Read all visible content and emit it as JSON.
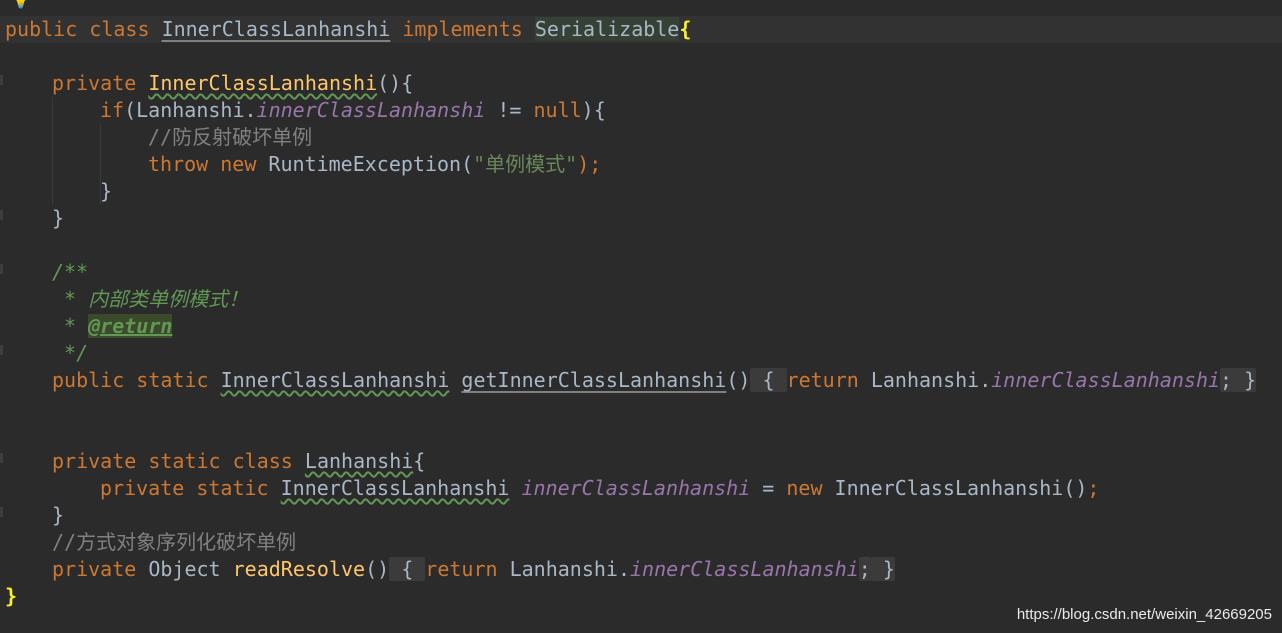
{
  "editor": {
    "lines": {
      "l1": {
        "kw1": "public",
        "kw2": "class",
        "name": "InnerClassLanhanshi",
        "kw3": "implements",
        "iface": "Serializable",
        "brace": "{"
      },
      "l3": {
        "kw1": "private",
        "name": "InnerClassLanhanshi",
        "rest": "(){"
      },
      "l4": {
        "kw": "if",
        "p1": "(Lanhanshi.",
        "field": "innerClassLanhanshi",
        "op": " != ",
        "nul": "null",
        "p2": "){"
      },
      "l5": {
        "comment": "//防反射破坏单例"
      },
      "l6": {
        "kw1": "throw",
        "kw2": "new",
        "cls": " RuntimeException(",
        "str": "\"单例模式\"",
        "end": ");"
      },
      "l7": {
        "text": "}"
      },
      "l8": {
        "text": "}"
      },
      "l10": {
        "text": "/**"
      },
      "l11": {
        "text": " * 内部类单例模式！"
      },
      "l12": {
        "prefix": " * ",
        "tag": "@return"
      },
      "l13": {
        "text": " */"
      },
      "l14": {
        "kw1": "public",
        "kw2": "static",
        "type": "InnerClassLanhanshi",
        "method": "getInnerClassLanhanshi",
        "paren": "()",
        "fold_open": " { ",
        "kw3": "return",
        "ref": " Lanhanshi.",
        "field": "innerClassLanhanshi",
        "semi": ";",
        "fold_close": " }"
      },
      "l17": {
        "kw1": "private",
        "kw2": "static",
        "kw3": "class",
        "name": "Lanhanshi",
        "brace": "{"
      },
      "l18": {
        "kw1": "private",
        "kw2": "static",
        "type": "InnerClassLanhanshi",
        "field": "innerClassLanhanshi",
        "eq": " = ",
        "kw3": "new",
        "ctor": " InnerClassLanhanshi()",
        "semi": ";"
      },
      "l19": {
        "text": "}"
      },
      "l20": {
        "comment": "//方式对象序列化破坏单例"
      },
      "l21": {
        "kw1": "private",
        "type": " Object ",
        "method": "readResolve",
        "paren": "()",
        "fold_open": " { ",
        "kw2": "return",
        "ref": " Lanhanshi.",
        "field": "innerClassLanhanshi",
        "semi": ";",
        "fold_close": " }"
      },
      "l22": {
        "brace": "}"
      }
    }
  },
  "watermark": "https://blog.csdn.net/weixin_42669205",
  "colors": {
    "background": "#2b2b2b",
    "keyword": "#cc7832",
    "declaration": "#ffc66d",
    "static_field": "#9876aa",
    "comment": "#808080",
    "javadoc": "#629755",
    "string": "#6a8759",
    "text": "#a9b7c6"
  }
}
